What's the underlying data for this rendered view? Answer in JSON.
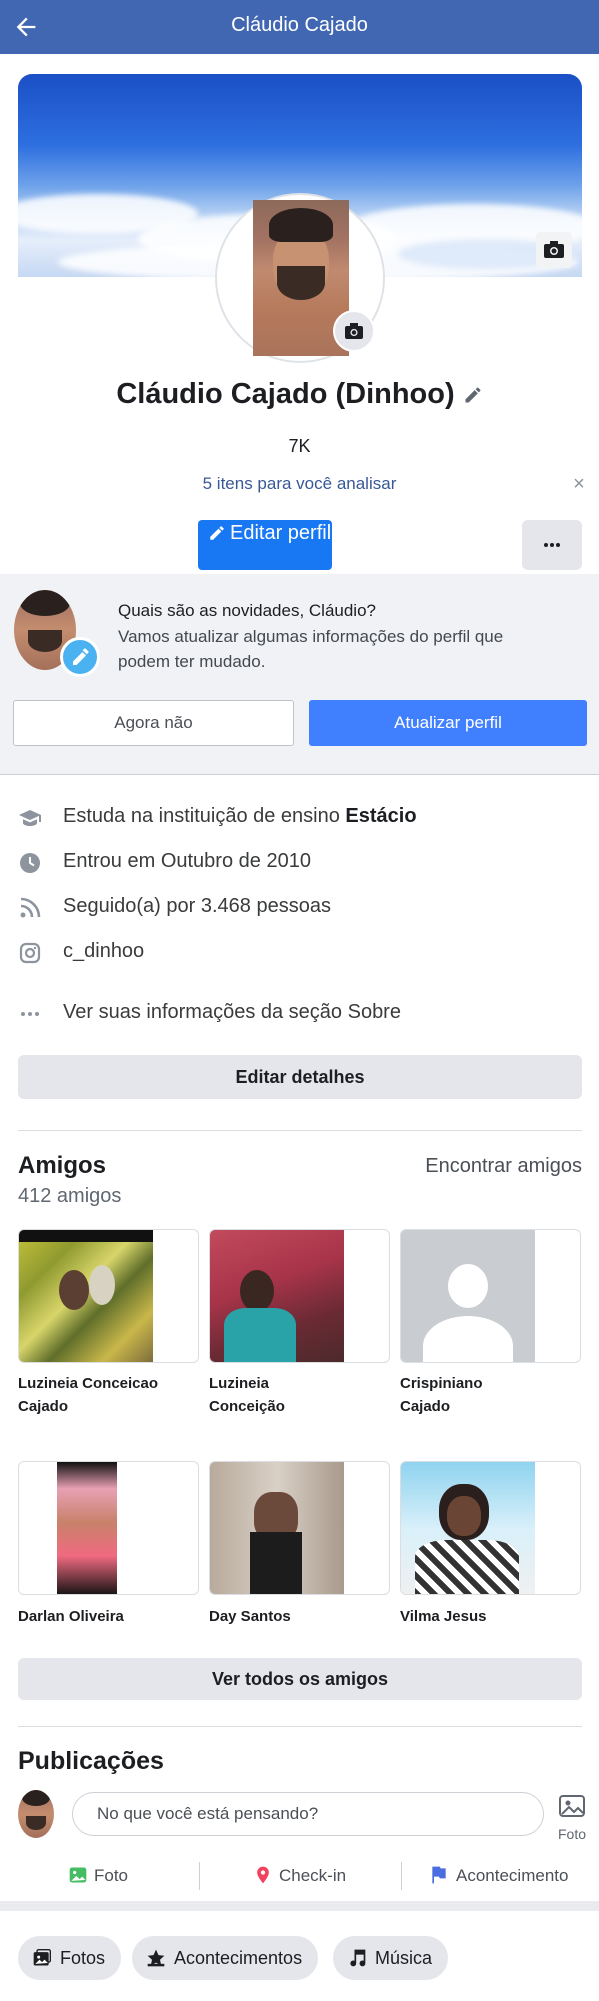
{
  "header": {
    "title": "Cláudio Cajado"
  },
  "profile": {
    "name": "Cláudio Cajado (Dinhoo)",
    "followers_short": "7K",
    "review_link": "5 itens para você analisar",
    "close_symbol": "×",
    "edit_profile_label": "Editar perfil"
  },
  "novidades": {
    "title": "Quais são as novidades, Cláudio?",
    "subtitle": "Vamos atualizar algumas informações do perfil que podem ter mudado.",
    "not_now_label": "Agora não",
    "update_label": "Atualizar perfil"
  },
  "details": {
    "education_prefix": "Estuda na instituição de ensino ",
    "education_bold": "Estácio",
    "joined": "Entrou em Outubro de 2010",
    "followed_by": "Seguido(a) por 3.468 pessoas",
    "instagram": "c_dinhoo",
    "about_link": "Ver suas informações da seção Sobre",
    "edit_details_label": "Editar detalhes"
  },
  "friends": {
    "heading": "Amigos",
    "count": "412 amigos",
    "find_label": "Encontrar amigos",
    "see_all_label": "Ver todos os amigos",
    "items": [
      {
        "name": "Luzineia Conceicao Cajado"
      },
      {
        "name": "Luzineia Conceição"
      },
      {
        "name": "Crispiniano Cajado"
      },
      {
        "name": "Darlan Oliveira"
      },
      {
        "name": "Day Santos"
      },
      {
        "name": "Vilma Jesus"
      }
    ]
  },
  "publications": {
    "heading": "Publicações",
    "composer_placeholder": "No que você está pensando?",
    "photo_small_label": "Foto",
    "actions": {
      "photo": "Foto",
      "checkin": "Check-in",
      "event": "Acontecimento"
    }
  },
  "bottom_tabs": {
    "photos": "Fotos",
    "events": "Acontecimentos",
    "music": "Música"
  },
  "colors": {
    "header": "#4267b2",
    "primary": "#1877f2",
    "update": "#4080ff",
    "link": "#385898"
  },
  "icons": [
    "back-arrow-icon",
    "camera-icon",
    "pencil-icon",
    "graduation-cap-icon",
    "clock-icon",
    "rss-icon",
    "instagram-icon",
    "dots-icon",
    "photo-icon",
    "location-pin-icon",
    "flag-icon",
    "star-icon",
    "music-note-icon"
  ]
}
